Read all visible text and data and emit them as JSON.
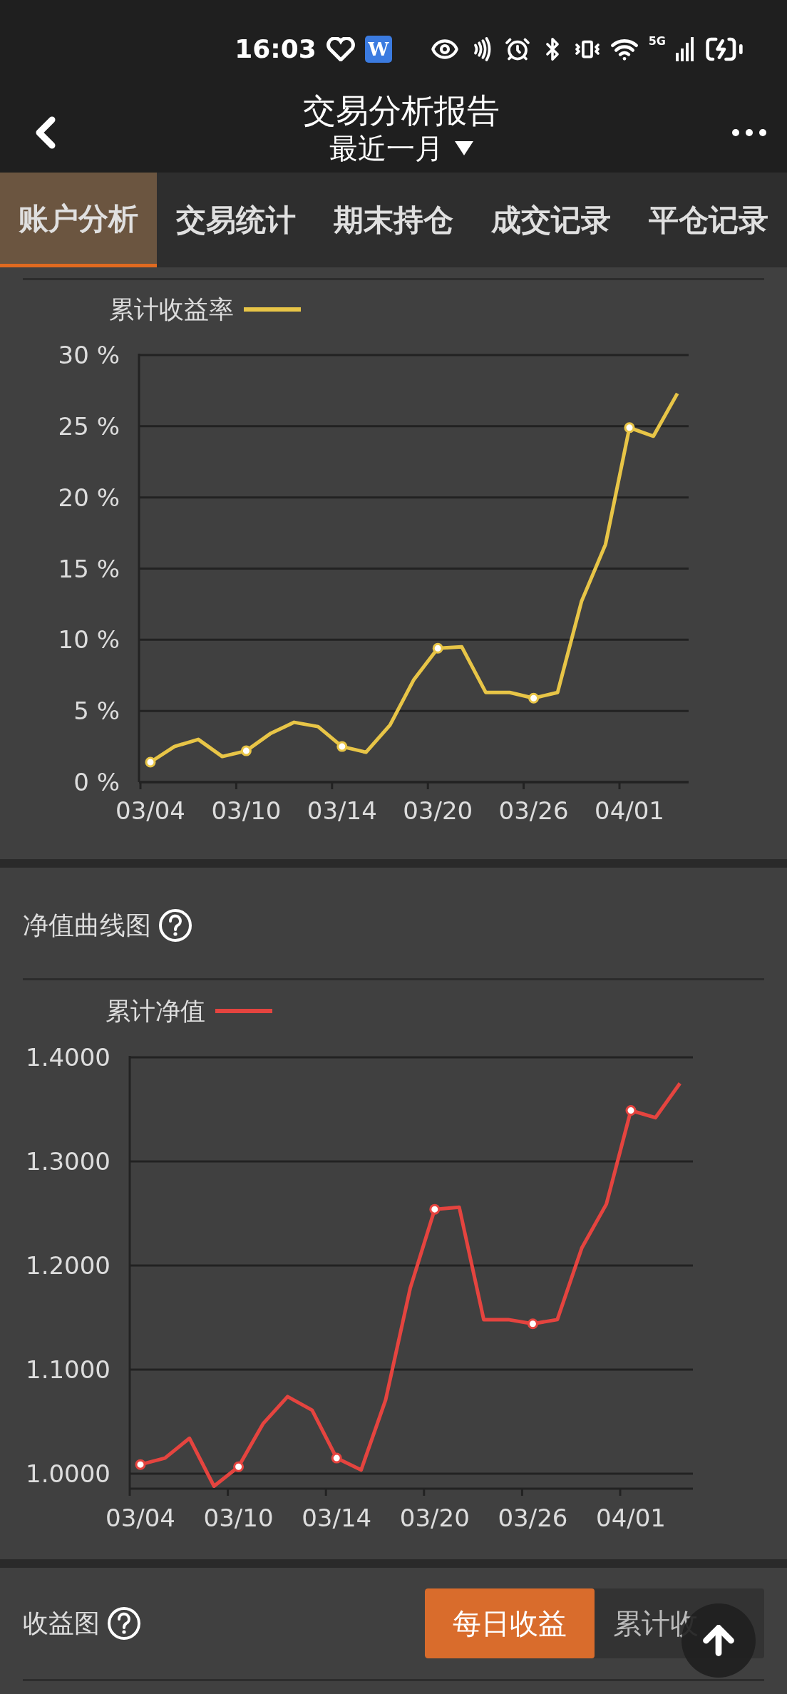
{
  "status_bar": {
    "time": "16:03",
    "app_letter": "W",
    "network": "5G"
  },
  "header": {
    "title": "交易分析报告",
    "period": "最近一月"
  },
  "tabs": [
    {
      "label": "账户分析",
      "selected": true
    },
    {
      "label": "交易统计",
      "selected": false
    },
    {
      "label": "期末持仓",
      "selected": false
    },
    {
      "label": "成交记录",
      "selected": false
    },
    {
      "label": "平仓记录",
      "selected": false
    }
  ],
  "return_chart": {
    "chart_data": {
      "type": "line",
      "series": [
        {
          "name": "累计收益率",
          "color": "#e8c547",
          "values": [
            1.4,
            2.5,
            3.0,
            1.8,
            2.2,
            3.4,
            4.2,
            3.9,
            2.5,
            2.1,
            4.0,
            7.2,
            9.4,
            9.5,
            6.3,
            6.3,
            5.9,
            6.3,
            12.7,
            16.7,
            24.9,
            24.3,
            27.3
          ]
        }
      ],
      "ylim": [
        0,
        30
      ],
      "yticks": [
        {
          "value": 0,
          "label": "0 %"
        },
        {
          "value": 5,
          "label": "5 %"
        },
        {
          "value": 10,
          "label": "10 %"
        },
        {
          "value": 15,
          "label": "15 %"
        },
        {
          "value": 20,
          "label": "20 %"
        },
        {
          "value": 25,
          "label": "25 %"
        },
        {
          "value": 30,
          "label": "30 %"
        }
      ],
      "grid": true,
      "categories": [
        "03/04",
        null,
        null,
        null,
        "03/10",
        null,
        null,
        null,
        "03/14",
        null,
        null,
        null,
        "03/20",
        null,
        null,
        null,
        "03/26",
        null,
        null,
        null,
        "04/01",
        null,
        null
      ]
    }
  },
  "nav_section": {
    "title": "净值曲线图",
    "chart_data": {
      "type": "line",
      "series": [
        {
          "name": "累计净值",
          "color": "#e5443f",
          "values": [
            1.0088,
            1.015,
            1.034,
            0.988,
            1.0067,
            1.048,
            1.074,
            1.061,
            1.015,
            1.0036,
            1.071,
            1.178,
            1.254,
            1.256,
            1.148,
            1.148,
            1.144,
            1.148,
            1.217,
            1.259,
            1.349,
            1.342,
            1.375
          ]
        }
      ],
      "ylim": [
        0.9856,
        1.4
      ],
      "yticks": [
        {
          "value": 1.0,
          "label": "1.0000"
        },
        {
          "value": 1.1,
          "label": "1.1000"
        },
        {
          "value": 1.2,
          "label": "1.2000"
        },
        {
          "value": 1.3,
          "label": "1.3000"
        },
        {
          "value": 1.4,
          "label": "1.4000"
        }
      ],
      "grid": true,
      "categories": [
        "03/04",
        null,
        null,
        null,
        "03/10",
        null,
        null,
        null,
        "03/14",
        null,
        null,
        null,
        "03/20",
        null,
        null,
        null,
        "03/26",
        null,
        null,
        null,
        "04/01",
        null,
        null
      ]
    }
  },
  "profit_section": {
    "title": "收益图",
    "toggle": [
      {
        "label": "每日收益",
        "selected": true
      },
      {
        "label": "累计收",
        "selected": false
      }
    ]
  }
}
